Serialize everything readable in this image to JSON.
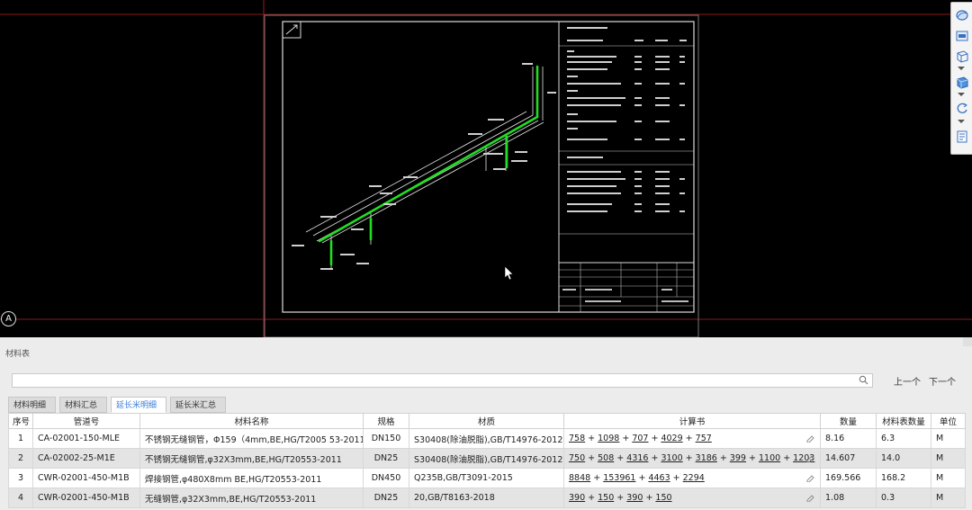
{
  "viewport": {
    "axis_label": "A"
  },
  "viewbar": {
    "icons": [
      "ellipse-view-icon",
      "layer-icon",
      "box-view-icon",
      "solid-cube-icon",
      "rotate-icon",
      "report-icon"
    ]
  },
  "panel": {
    "title": "材料表",
    "search_placeholder": "",
    "prev_label": "上一个",
    "next_label": "下一个",
    "tabs": [
      {
        "label": "材料明细表",
        "active": false
      },
      {
        "label": "材料汇总表",
        "active": false
      },
      {
        "label": "延长米明细表",
        "active": true
      },
      {
        "label": "延长米汇总表",
        "active": false
      }
    ],
    "columns": [
      "序号",
      "管道号",
      "材料名称",
      "规格",
      "材质",
      "计算书",
      "数量",
      "材料表数量",
      "单位"
    ],
    "rows": [
      {
        "idx": "1",
        "pipe": "CA-02001-150-MLE",
        "name": "不锈钢无缝钢管，Φ159（4mm,BE,HG/T2005 53-2011",
        "spec": "DN150",
        "material": "S30408(除油脱脂),GB/T14976-2012",
        "calc": [
          "758",
          "1098",
          "707",
          "4029",
          "757"
        ],
        "qty": "8.16",
        "mqty": "6.3",
        "unit": "M"
      },
      {
        "idx": "2",
        "pipe": "CA-02002-25-M1E",
        "name": "不锈钢无缝钢管,φ32X3mm,BE,HG/T20553-2011",
        "spec": "DN25",
        "material": "S30408(除油脱脂),GB/T14976-2012",
        "calc": [
          "750",
          "508",
          "4316",
          "3100",
          "3186",
          "399",
          "1100",
          "1203"
        ],
        "qty": "14.607",
        "mqty": "14.0",
        "unit": "M"
      },
      {
        "idx": "3",
        "pipe": "CWR-02001-450-M1B",
        "name": "焊接钢管,φ480X8mm BE,HG/T20553-2011",
        "spec": "DN450",
        "material": "Q235B,GB/T3091-2015",
        "calc": [
          "8848",
          "153961",
          "4463",
          "2294"
        ],
        "qty": "169.566",
        "mqty": "168.2",
        "unit": "M"
      },
      {
        "idx": "4",
        "pipe": "CWR-02001-450-M1B",
        "name": "无缝钢管,φ32X3mm,BE,HG/T20553-2011",
        "spec": "DN25",
        "material": "20,GB/T8163-2018",
        "calc": [
          "390",
          "150",
          "390",
          "150"
        ],
        "qty": "1.08",
        "mqty": "0.3",
        "unit": "M"
      }
    ]
  }
}
